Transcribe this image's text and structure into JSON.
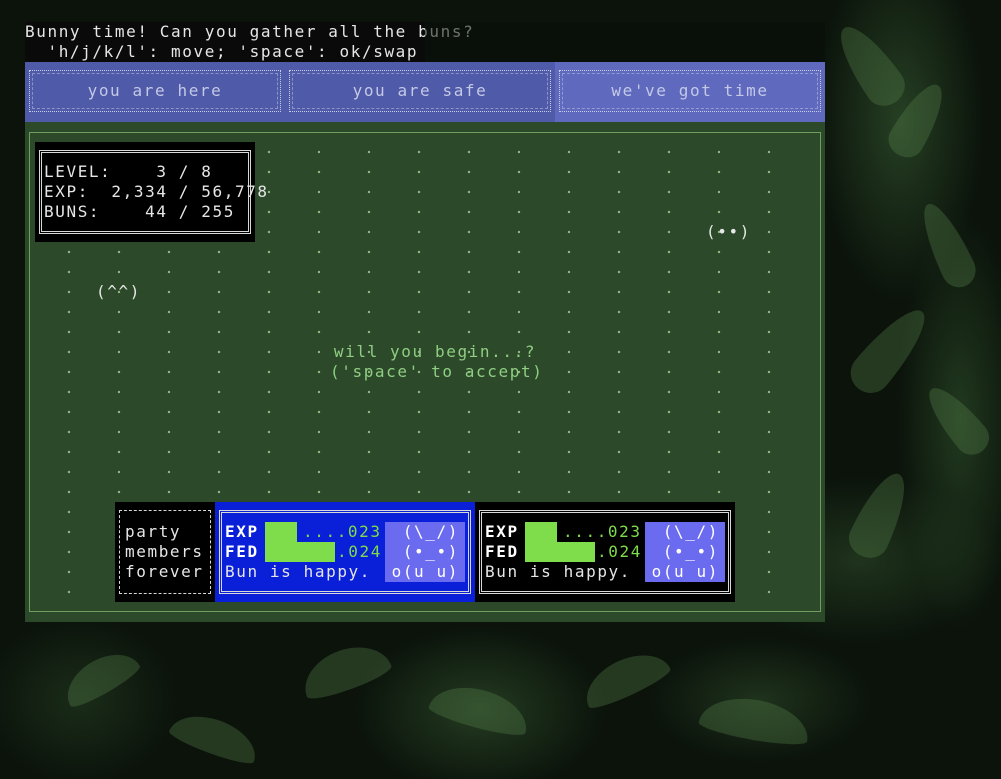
{
  "header": {
    "line1": "Bunny time! Can you gather all the buns?",
    "line2": "  'h/j/k/l': move; 'space': ok/swap"
  },
  "tabs": [
    {
      "label": "you are here",
      "active": false
    },
    {
      "label": "you are safe",
      "active": false
    },
    {
      "label": "we've got time",
      "active": true
    }
  ],
  "stats": {
    "level": "LEVEL:    3 / 8",
    "exp": "EXP:  2,334 / 56,778",
    "buns": "BUNS:    44 / 255"
  },
  "sprites": {
    "bun_right": "(••)",
    "bun_left": "(^^)"
  },
  "prompt": {
    "line1": "will you begin...?",
    "line2": "('space' to accept)"
  },
  "party": {
    "lines": [
      "party",
      "members",
      "forever"
    ]
  },
  "members": [
    {
      "selected": true,
      "exp_label": "EXP",
      "exp_fill": 0.31,
      "exp_value": "....023",
      "fed_label": "FED",
      "fed_fill": 0.69,
      "fed_value": ".024",
      "status": "Bun is happy.",
      "face": [
        "(\\_/)",
        "(•_•)",
        "o(u u)"
      ]
    },
    {
      "selected": false,
      "exp_label": "EXP",
      "exp_fill": 0.31,
      "exp_value": "....023",
      "fed_label": "FED",
      "fed_fill": 0.69,
      "fed_value": ".024",
      "status": "Bun is happy.",
      "face": [
        "(\\_/)",
        "(•_•)",
        "o(u u)"
      ]
    }
  ],
  "colors": {
    "board": "#2c4a29",
    "tab_bar": "#4f5aa8",
    "selected_card": "#0a20d8",
    "bar_fill": "#7fdc4a",
    "face_bg": "#6b6bf0",
    "prompt_text": "#8fce83"
  }
}
